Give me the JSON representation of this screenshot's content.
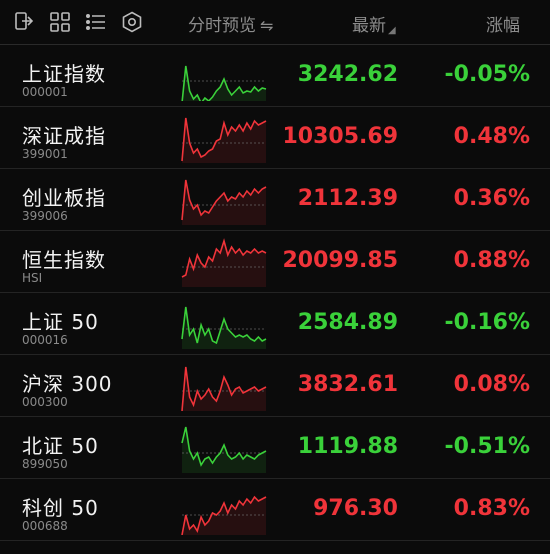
{
  "colors": {
    "up": "#f0343a",
    "down": "#3ad13a",
    "background": "#0b0b0b"
  },
  "header": {
    "icons": [
      "export-icon",
      "grid-icon",
      "list-icon",
      "settings-icon"
    ],
    "preview_label": "分时预览",
    "preview_toggle_symbol": "⇋",
    "latest_label": "最新",
    "change_label": "涨幅"
  },
  "rows": [
    {
      "name": "上证指数",
      "code": "000001",
      "price": "3242.62",
      "change": "-0.05%",
      "direction": "down",
      "spark": [
        52,
        15,
        40,
        48,
        44,
        52,
        47,
        50,
        46,
        40,
        36,
        28,
        38,
        44,
        40,
        36,
        42,
        40,
        41,
        36,
        40,
        37,
        38
      ]
    },
    {
      "name": "深证成指",
      "code": "399001",
      "price": "10305.69",
      "change": "0.48%",
      "direction": "up",
      "spark": [
        48,
        5,
        30,
        40,
        36,
        44,
        42,
        38,
        36,
        28,
        26,
        10,
        22,
        14,
        18,
        12,
        18,
        10,
        16,
        8,
        12,
        10,
        8
      ]
    },
    {
      "name": "创业板指",
      "code": "399006",
      "price": "2112.39",
      "change": "0.36%",
      "direction": "up",
      "spark": [
        45,
        5,
        25,
        34,
        30,
        40,
        36,
        38,
        32,
        26,
        22,
        18,
        26,
        22,
        24,
        18,
        22,
        16,
        20,
        14,
        18,
        14,
        12
      ]
    },
    {
      "name": "恒生指数",
      "code": "HSI",
      "price": "20099.85",
      "change": "0.88%",
      "direction": "up",
      "spark": [
        40,
        38,
        22,
        32,
        18,
        26,
        30,
        20,
        24,
        12,
        16,
        4,
        18,
        10,
        16,
        12,
        18,
        14,
        16,
        12,
        16,
        14,
        16
      ]
    },
    {
      "name": "上证 50",
      "code": "000016",
      "price": "2584.89",
      "change": "-0.16%",
      "direction": "down",
      "spark": [
        40,
        8,
        36,
        30,
        44,
        26,
        36,
        30,
        42,
        44,
        32,
        20,
        30,
        34,
        38,
        36,
        38,
        36,
        40,
        42,
        38,
        42,
        40
      ]
    },
    {
      "name": "沪深 300",
      "code": "000300",
      "price": "3832.61",
      "change": "0.08%",
      "direction": "up",
      "spark": [
        50,
        6,
        36,
        44,
        30,
        38,
        34,
        28,
        36,
        40,
        30,
        16,
        24,
        34,
        28,
        26,
        32,
        30,
        28,
        26,
        30,
        28,
        26
      ]
    },
    {
      "name": "北证 50",
      "code": "899050",
      "price": "1119.88",
      "change": "-0.51%",
      "direction": "down",
      "spark": [
        20,
        4,
        28,
        36,
        30,
        42,
        36,
        34,
        40,
        34,
        30,
        22,
        32,
        36,
        34,
        30,
        36,
        32,
        34,
        36,
        32,
        30,
        28
      ]
    },
    {
      "name": "科创 50",
      "code": "000688",
      "price": "976.30",
      "change": "0.83%",
      "direction": "up",
      "spark": [
        50,
        30,
        44,
        40,
        46,
        32,
        40,
        36,
        28,
        30,
        26,
        18,
        28,
        20,
        24,
        16,
        20,
        14,
        18,
        12,
        16,
        14,
        12
      ]
    }
  ]
}
